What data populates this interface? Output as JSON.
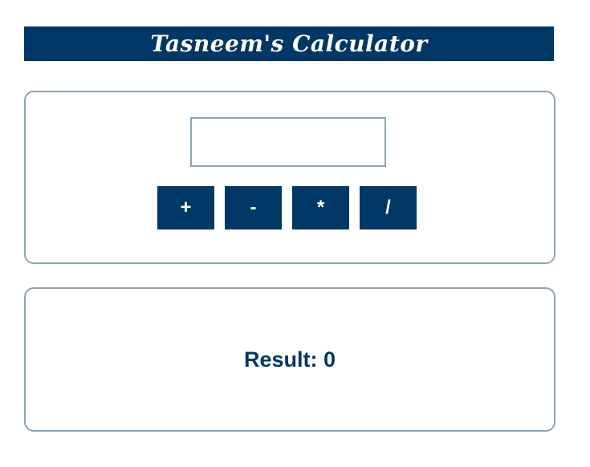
{
  "app": {
    "title": "Tasneem's Calculator"
  },
  "input": {
    "value": "",
    "placeholder": ""
  },
  "operations": [
    {
      "label": "+"
    },
    {
      "label": "-"
    },
    {
      "label": "*"
    },
    {
      "label": "/"
    }
  ],
  "result": {
    "text": "Result: 0"
  },
  "colors": {
    "primary": "#003764",
    "border": "#8da3b8",
    "background": "#ffffff"
  }
}
